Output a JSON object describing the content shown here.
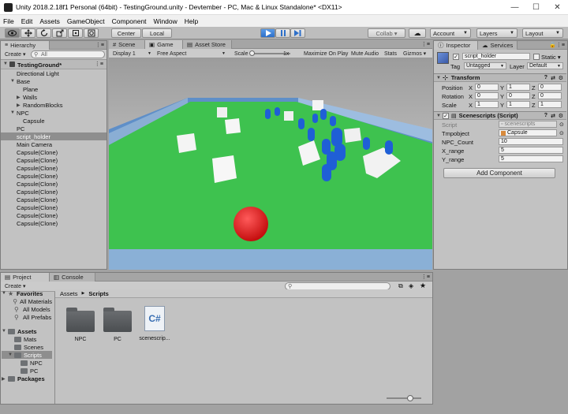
{
  "window": {
    "title": "Unity 2018.2.18f1 Personal (64bit) - TestingGround.unity - Devtember - PC, Mac & Linux Standalone* <DX11>",
    "minimize": "—",
    "maximize": "☐",
    "close": "✕"
  },
  "menu": [
    "File",
    "Edit",
    "Assets",
    "GameObject",
    "Component",
    "Window",
    "Help"
  ],
  "toolbar": {
    "pivot_center": "Center",
    "pivot_local": "Local",
    "collab": "Collab ▾",
    "cloud_icon": "☁",
    "account": "Account",
    "layers": "Layers",
    "layout": "Layout"
  },
  "hierarchy": {
    "tab": "Hierarchy",
    "create": "Create ▾",
    "search_placeholder": "All",
    "scene_name": "TestingGround*",
    "items": [
      {
        "label": "Directional Light",
        "indent": 1,
        "arrow": ""
      },
      {
        "label": "Base",
        "indent": 1,
        "arrow": "▼"
      },
      {
        "label": "Plane",
        "indent": 2,
        "arrow": ""
      },
      {
        "label": "Walls",
        "indent": 2,
        "arrow": "▶"
      },
      {
        "label": "RandomBlocks",
        "indent": 2,
        "arrow": "▶"
      },
      {
        "label": "NPC",
        "indent": 1,
        "arrow": "▼"
      },
      {
        "label": "Capsule",
        "indent": 2,
        "arrow": ""
      },
      {
        "label": "PC",
        "indent": 1,
        "arrow": ""
      },
      {
        "label": "script_holder",
        "indent": 1,
        "arrow": "",
        "selected": true
      },
      {
        "label": "Main Camera",
        "indent": 1,
        "arrow": ""
      },
      {
        "label": "Capsule(Clone)",
        "indent": 1,
        "arrow": ""
      },
      {
        "label": "Capsule(Clone)",
        "indent": 1,
        "arrow": ""
      },
      {
        "label": "Capsule(Clone)",
        "indent": 1,
        "arrow": ""
      },
      {
        "label": "Capsule(Clone)",
        "indent": 1,
        "arrow": ""
      },
      {
        "label": "Capsule(Clone)",
        "indent": 1,
        "arrow": ""
      },
      {
        "label": "Capsule(Clone)",
        "indent": 1,
        "arrow": ""
      },
      {
        "label": "Capsule(Clone)",
        "indent": 1,
        "arrow": ""
      },
      {
        "label": "Capsule(Clone)",
        "indent": 1,
        "arrow": ""
      },
      {
        "label": "Capsule(Clone)",
        "indent": 1,
        "arrow": ""
      },
      {
        "label": "Capsule(Clone)",
        "indent": 1,
        "arrow": ""
      }
    ]
  },
  "center_tabs": {
    "scene": "Scene",
    "game": "Game",
    "asset_store": "Asset Store"
  },
  "game_bar": {
    "display": "Display 1",
    "aspect": "Free Aspect",
    "scale_label": "Scale",
    "scale_value": "1x",
    "maximize": "Maximize On Play",
    "mute": "Mute Audio",
    "stats": "Stats",
    "gizmos": "Gizmos ▾"
  },
  "inspector": {
    "tab_inspector": "Inspector",
    "tab_services": "Services",
    "object_name": "script_holder",
    "static_label": "Static ▾",
    "tag_label": "Tag",
    "tag_value": "Untagged",
    "layer_label": "Layer",
    "layer_value": "Default",
    "transform_title": "Transform",
    "position_label": "Position",
    "rotation_label": "Rotation",
    "scale_label": "Scale",
    "axis_x": "X",
    "axis_y": "Y",
    "axis_z": "Z",
    "position": {
      "x": "0",
      "y": "1",
      "z": "0"
    },
    "rotation": {
      "x": "0",
      "y": "0",
      "z": "0"
    },
    "scale": {
      "x": "1",
      "y": "1",
      "z": "1"
    },
    "script_comp_title": "Scenescripts (Script)",
    "script_label": "Script",
    "script_value": "scenescripts",
    "tmp_label": "Tmpobject",
    "tmp_value": "Capsule",
    "npc_count_label": "NPC_Count",
    "npc_count_value": "10",
    "xrange_label": "X_range",
    "xrange_value": "5",
    "yrange_label": "Y_range",
    "yrange_value": "5",
    "add_component": "Add Component"
  },
  "project": {
    "tab_project": "Project",
    "tab_console": "Console",
    "create": "Create ▾",
    "favorites": "Favorites",
    "fav_items": [
      "All Materials",
      "All Models",
      "All Prefabs"
    ],
    "assets_root": "Assets",
    "asset_folders": [
      "Mats",
      "Scenes",
      "Scripts"
    ],
    "script_subfolders": [
      "NPC",
      "PC"
    ],
    "packages": "Packages",
    "breadcrumb_root": "Assets",
    "breadcrumb_sep": "▶",
    "breadcrumb_current": "Scripts",
    "files": [
      {
        "name": "NPC",
        "kind": "folder"
      },
      {
        "name": "PC",
        "kind": "folder"
      },
      {
        "name": "scenescrip...",
        "kind": "cs",
        "glyph": "C#"
      }
    ]
  },
  "colors": {
    "ground": "#3ec24f",
    "sky": "#bcbcbc",
    "capsule": "#1f5fd6",
    "ball": "#e02020",
    "selection": "#8e8e8e"
  }
}
